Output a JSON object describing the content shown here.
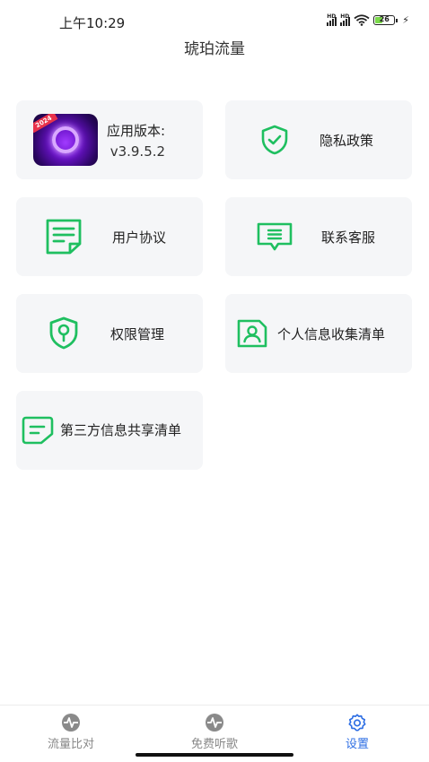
{
  "status_bar": {
    "time": "上午10:29",
    "battery": "26"
  },
  "page": {
    "title": "琥珀流量"
  },
  "cards": {
    "app_version": {
      "label": "应用版本:",
      "value": "v3.9.5.2",
      "badge": "2024"
    },
    "privacy_policy": {
      "label": "隐私政策",
      "icon": "shield-check-icon"
    },
    "user_agreement": {
      "label": "用户协议",
      "icon": "document-icon"
    },
    "customer_service": {
      "label": "联系客服",
      "icon": "message-icon"
    },
    "permission_management": {
      "label": "权限管理",
      "icon": "shield-key-icon"
    },
    "personal_info_list": {
      "label": "个人信息收集清单",
      "icon": "person-card-icon"
    },
    "third_party_list": {
      "label": "第三方信息共享清单",
      "icon": "note-icon"
    }
  },
  "tab_bar": {
    "tabs": [
      {
        "label": "流量比对",
        "icon": "pulse-icon",
        "active": false
      },
      {
        "label": "免费听歌",
        "icon": "pulse-icon",
        "active": false
      },
      {
        "label": "设置",
        "icon": "gear-icon",
        "active": true
      }
    ]
  },
  "colors": {
    "accent_green": "#1fbf60",
    "active_blue": "#2f6fe4",
    "card_bg": "#f5f6f8"
  }
}
